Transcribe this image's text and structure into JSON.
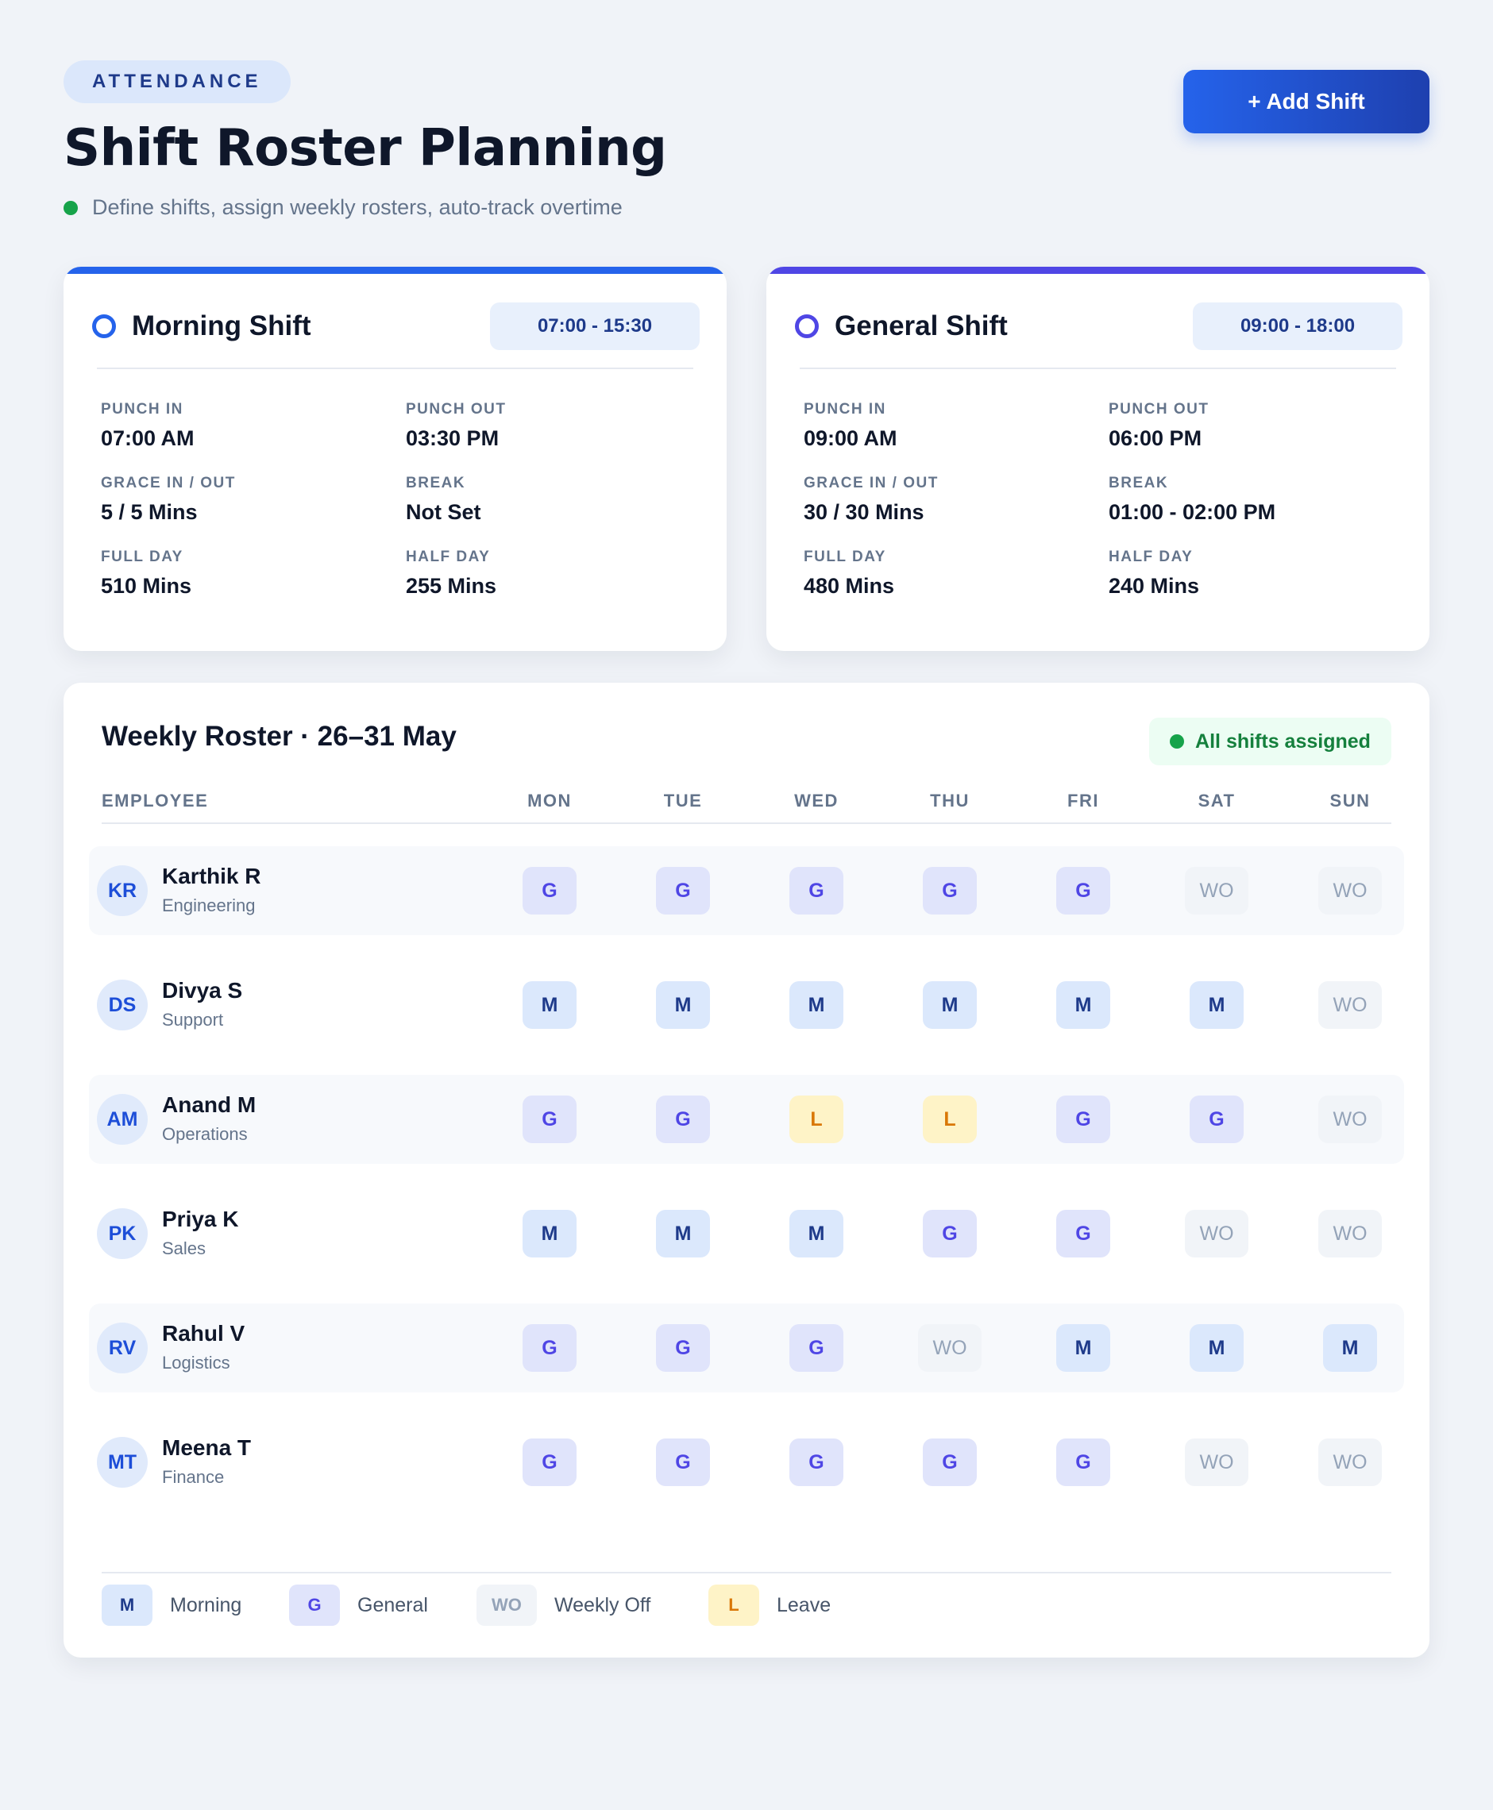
{
  "header": {
    "eyebrow": "ATTENDANCE",
    "title": "Shift Roster Planning",
    "subtitle": "Define shifts, assign weekly rosters, auto-track overtime",
    "add_button": "+ Add Shift"
  },
  "shifts": [
    {
      "name": "Morning Shift",
      "time": "07:00 - 15:30",
      "accent": "#2563eb",
      "fields": [
        {
          "label": "PUNCH IN",
          "value": "07:00 AM"
        },
        {
          "label": "PUNCH OUT",
          "value": "03:30 PM"
        },
        {
          "label": "GRACE IN / OUT",
          "value": "5 / 5 Mins"
        },
        {
          "label": "BREAK",
          "value": "Not Set"
        },
        {
          "label": "FULL DAY",
          "value": "510 Mins"
        },
        {
          "label": "HALF DAY",
          "value": "255 Mins"
        }
      ]
    },
    {
      "name": "General Shift",
      "time": "09:00 - 18:00",
      "accent": "#4f46e5",
      "fields": [
        {
          "label": "PUNCH IN",
          "value": "09:00 AM"
        },
        {
          "label": "PUNCH OUT",
          "value": "06:00 PM"
        },
        {
          "label": "GRACE IN / OUT",
          "value": "30 / 30 Mins"
        },
        {
          "label": "BREAK",
          "value": "01:00 - 02:00 PM"
        },
        {
          "label": "FULL DAY",
          "value": "480 Mins"
        },
        {
          "label": "HALF DAY",
          "value": "240 Mins"
        }
      ]
    }
  ],
  "roster": {
    "title": "Weekly Roster · 26–31 May",
    "status": "All shifts assigned",
    "employee_header": "EMPLOYEE",
    "days": [
      "MON",
      "TUE",
      "WED",
      "THU",
      "FRI",
      "SAT",
      "SUN"
    ],
    "employees": [
      {
        "initials": "KR",
        "name": "Karthik R",
        "dept": "Engineering",
        "shifts": [
          "G",
          "G",
          "G",
          "G",
          "G",
          "WO",
          "WO"
        ]
      },
      {
        "initials": "DS",
        "name": "Divya S",
        "dept": "Support",
        "shifts": [
          "M",
          "M",
          "M",
          "M",
          "M",
          "M",
          "WO"
        ]
      },
      {
        "initials": "AM",
        "name": "Anand M",
        "dept": "Operations",
        "shifts": [
          "G",
          "G",
          "L",
          "L",
          "G",
          "G",
          "WO"
        ]
      },
      {
        "initials": "PK",
        "name": "Priya K",
        "dept": "Sales",
        "shifts": [
          "M",
          "M",
          "M",
          "G",
          "G",
          "WO",
          "WO"
        ]
      },
      {
        "initials": "RV",
        "name": "Rahul V",
        "dept": "Logistics",
        "shifts": [
          "G",
          "G",
          "G",
          "WO",
          "M",
          "M",
          "M"
        ]
      },
      {
        "initials": "MT",
        "name": "Meena T",
        "dept": "Finance",
        "shifts": [
          "G",
          "G",
          "G",
          "G",
          "G",
          "WO",
          "WO"
        ]
      }
    ],
    "legend": [
      {
        "code": "M",
        "label": "Morning"
      },
      {
        "code": "G",
        "label": "General"
      },
      {
        "code": "WO",
        "label": "Weekly Off"
      },
      {
        "code": "L",
        "label": "Leave"
      }
    ]
  }
}
